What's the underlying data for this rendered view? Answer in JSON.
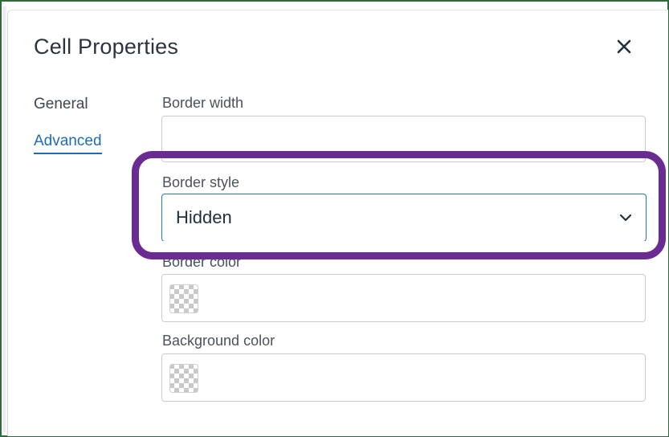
{
  "dialog": {
    "title": "Cell Properties"
  },
  "tabs": [
    {
      "label": "General",
      "active": false
    },
    {
      "label": "Advanced",
      "active": true
    }
  ],
  "fields": {
    "border_width": {
      "label": "Border width",
      "value": ""
    },
    "border_style": {
      "label": "Border style",
      "value": "Hidden"
    },
    "border_color": {
      "label": "Border color",
      "value": ""
    },
    "background_color": {
      "label": "Background color",
      "value": ""
    }
  },
  "icons": {
    "close": "close-icon",
    "dropdown": "chevron-down-icon",
    "swatch": "transparent-swatch-icon"
  },
  "colors": {
    "accent": "#1f6bb7",
    "focus_border": "#207ab7",
    "highlight": "#6a2c91",
    "frame": "#2e6b3a"
  }
}
